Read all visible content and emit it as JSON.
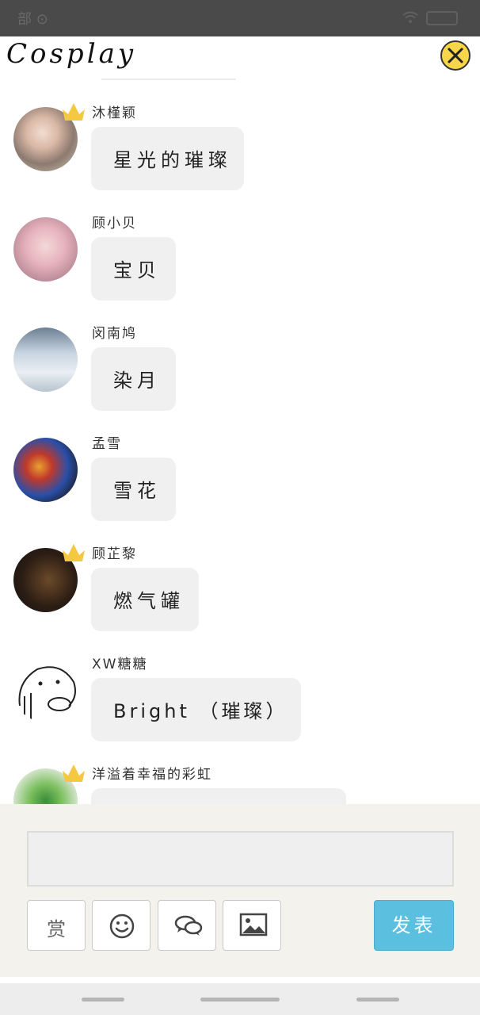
{
  "status_bar": {
    "carrier": "部 ⊙"
  },
  "header": {
    "title": "Cosplay"
  },
  "messages": [
    {
      "username": "沐槿颖",
      "text": "星光的璀璨",
      "has_crown": true,
      "avatar": "girl-portrait"
    },
    {
      "username": "顾小贝",
      "text": "宝贝",
      "has_crown": false,
      "avatar": "girl-pink"
    },
    {
      "username": "闵南鸠",
      "text": "染月",
      "has_crown": false,
      "avatar": "boy-portrait"
    },
    {
      "username": "孟雪",
      "text": "雪花",
      "has_crown": false,
      "avatar": "leaf-galaxy"
    },
    {
      "username": "顾芷黎",
      "text": "燃气罐",
      "has_crown": true,
      "avatar": "meme-text"
    },
    {
      "username": "XW糖糖",
      "text": "Bright （璀璨）",
      "has_crown": false,
      "avatar": "sketch-face"
    },
    {
      "username": "洋溢着幸福的彩虹",
      "text": "",
      "has_crown": true,
      "avatar": "clover"
    }
  ],
  "composer": {
    "input_value": "",
    "reward_label": "赏",
    "post_label": "发表",
    "post_color": "#5bc0e0"
  },
  "icons": {
    "close": "close-icon",
    "emoji": "smiley-icon",
    "chat": "chat-bubbles-icon",
    "image": "image-icon",
    "crown": "crown-icon"
  }
}
